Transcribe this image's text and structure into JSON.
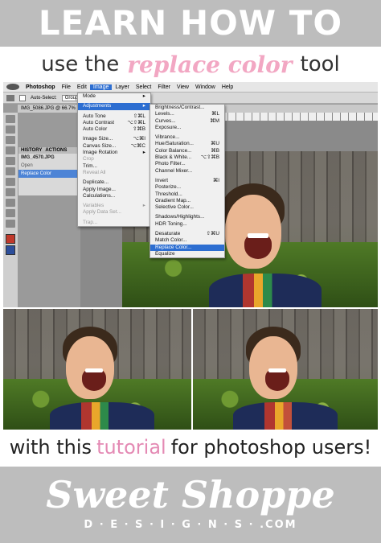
{
  "banner": {
    "title": "LEARN HOW TO"
  },
  "subtitle": {
    "before": "use the",
    "highlight": "replace color",
    "after": "tool"
  },
  "app": {
    "menubar": [
      "Photoshop",
      "File",
      "Edit",
      "Image",
      "Layer",
      "Select",
      "Filter",
      "View",
      "Window",
      "Help"
    ],
    "active_menu": "Image",
    "options": {
      "auto_select_label": "Auto-Select:",
      "auto_select_value": "Group"
    },
    "document_tab": "IMG_5086.JPG @ 66.7%",
    "panel": {
      "tabs": [
        "HISTORY",
        "ACTIONS"
      ],
      "rows": [
        "IMG_4570.JPG",
        "Open",
        "Replace Color"
      ]
    }
  },
  "image_menu": {
    "items": [
      {
        "label": "Mode",
        "shortcut": "▸",
        "state": "normal"
      },
      {
        "label": "",
        "shortcut": "",
        "state": "sep"
      },
      {
        "label": "Adjustments",
        "shortcut": "▸",
        "state": "hl"
      },
      {
        "label": "",
        "shortcut": "",
        "state": "sep"
      },
      {
        "label": "Auto Tone",
        "shortcut": "⇧⌘L",
        "state": "normal"
      },
      {
        "label": "Auto Contrast",
        "shortcut": "⌥⇧⌘L",
        "state": "normal"
      },
      {
        "label": "Auto Color",
        "shortcut": "⇧⌘B",
        "state": "normal"
      },
      {
        "label": "",
        "shortcut": "",
        "state": "sep"
      },
      {
        "label": "Image Size...",
        "shortcut": "⌥⌘I",
        "state": "normal"
      },
      {
        "label": "Canvas Size...",
        "shortcut": "⌥⌘C",
        "state": "normal"
      },
      {
        "label": "Image Rotation",
        "shortcut": "▸",
        "state": "normal"
      },
      {
        "label": "Crop",
        "shortcut": "",
        "state": "dis"
      },
      {
        "label": "Trim...",
        "shortcut": "",
        "state": "normal"
      },
      {
        "label": "Reveal All",
        "shortcut": "",
        "state": "dis"
      },
      {
        "label": "",
        "shortcut": "",
        "state": "sep"
      },
      {
        "label": "Duplicate...",
        "shortcut": "",
        "state": "normal"
      },
      {
        "label": "Apply Image...",
        "shortcut": "",
        "state": "normal"
      },
      {
        "label": "Calculations...",
        "shortcut": "",
        "state": "normal"
      },
      {
        "label": "",
        "shortcut": "",
        "state": "sep"
      },
      {
        "label": "Variables",
        "shortcut": "▸",
        "state": "dis"
      },
      {
        "label": "Apply Data Set...",
        "shortcut": "",
        "state": "dis"
      },
      {
        "label": "",
        "shortcut": "",
        "state": "sep"
      },
      {
        "label": "Trap...",
        "shortcut": "",
        "state": "dis"
      }
    ]
  },
  "adjustments_menu": {
    "items": [
      {
        "label": "Brightness/Contrast...",
        "shortcut": "",
        "state": "normal"
      },
      {
        "label": "Levels...",
        "shortcut": "⌘L",
        "state": "normal"
      },
      {
        "label": "Curves...",
        "shortcut": "⌘M",
        "state": "normal"
      },
      {
        "label": "Exposure...",
        "shortcut": "",
        "state": "normal"
      },
      {
        "label": "",
        "shortcut": "",
        "state": "sep"
      },
      {
        "label": "Vibrance...",
        "shortcut": "",
        "state": "normal"
      },
      {
        "label": "Hue/Saturation...",
        "shortcut": "⌘U",
        "state": "normal"
      },
      {
        "label": "Color Balance...",
        "shortcut": "⌘B",
        "state": "normal"
      },
      {
        "label": "Black & White...",
        "shortcut": "⌥⇧⌘B",
        "state": "normal"
      },
      {
        "label": "Photo Filter...",
        "shortcut": "",
        "state": "normal"
      },
      {
        "label": "Channel Mixer...",
        "shortcut": "",
        "state": "normal"
      },
      {
        "label": "",
        "shortcut": "",
        "state": "sep"
      },
      {
        "label": "Invert",
        "shortcut": "⌘I",
        "state": "normal"
      },
      {
        "label": "Posterize...",
        "shortcut": "",
        "state": "normal"
      },
      {
        "label": "Threshold...",
        "shortcut": "",
        "state": "normal"
      },
      {
        "label": "Gradient Map...",
        "shortcut": "",
        "state": "normal"
      },
      {
        "label": "Selective Color...",
        "shortcut": "",
        "state": "normal"
      },
      {
        "label": "",
        "shortcut": "",
        "state": "sep"
      },
      {
        "label": "Shadows/Highlights...",
        "shortcut": "",
        "state": "normal"
      },
      {
        "label": "HDR Toning...",
        "shortcut": "",
        "state": "normal"
      },
      {
        "label": "",
        "shortcut": "",
        "state": "sep"
      },
      {
        "label": "Desaturate",
        "shortcut": "⇧⌘U",
        "state": "normal"
      },
      {
        "label": "Match Color...",
        "shortcut": "",
        "state": "normal"
      },
      {
        "label": "Replace Color...",
        "shortcut": "",
        "state": "hl"
      },
      {
        "label": "Equalize",
        "shortcut": "",
        "state": "normal"
      }
    ]
  },
  "tagline": {
    "before": "with this",
    "highlight": "tutorial",
    "after": "for photoshop users!"
  },
  "brand": {
    "script": "Sweet Shoppe",
    "sub": "D · E · S · I · G · N · S · .COM"
  },
  "colors": {
    "banner_gray": "#bdbdbd",
    "pink": "#f2a7c3",
    "menu_highlight": "#2d6ed1"
  }
}
